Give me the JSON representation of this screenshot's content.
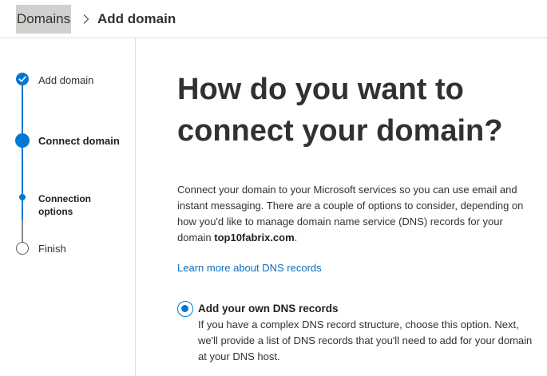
{
  "breadcrumb": {
    "parent": "Domains",
    "current": "Add domain"
  },
  "stepper": {
    "steps": [
      {
        "label": "Add domain",
        "state": "completed"
      },
      {
        "label": "Connect domain",
        "state": "current"
      },
      {
        "label": "Connection options",
        "state": "current-substep"
      },
      {
        "label": "Finish",
        "state": "upcoming"
      }
    ]
  },
  "main": {
    "title": "How do you want to connect your domain?",
    "description_prefix": "Connect your domain to your Microsoft services so you can use email and instant messaging. There are a couple of options to consider, depending on how you'd like to manage domain name service (DNS) records for your domain ",
    "domain": "top10fabrix.com",
    "description_suffix": ".",
    "learn_more_link": "Learn more about DNS records",
    "option": {
      "title": "Add your own DNS records",
      "description": "If you have a complex DNS record structure, choose this option. Next, we'll provide a list of DNS records that you'll need to add for your domain at your DNS host.",
      "selected": true
    }
  },
  "colors": {
    "accent": "#0078d4",
    "link": "#106ebe",
    "text": "#323130",
    "divider": "#e1dfdd"
  }
}
